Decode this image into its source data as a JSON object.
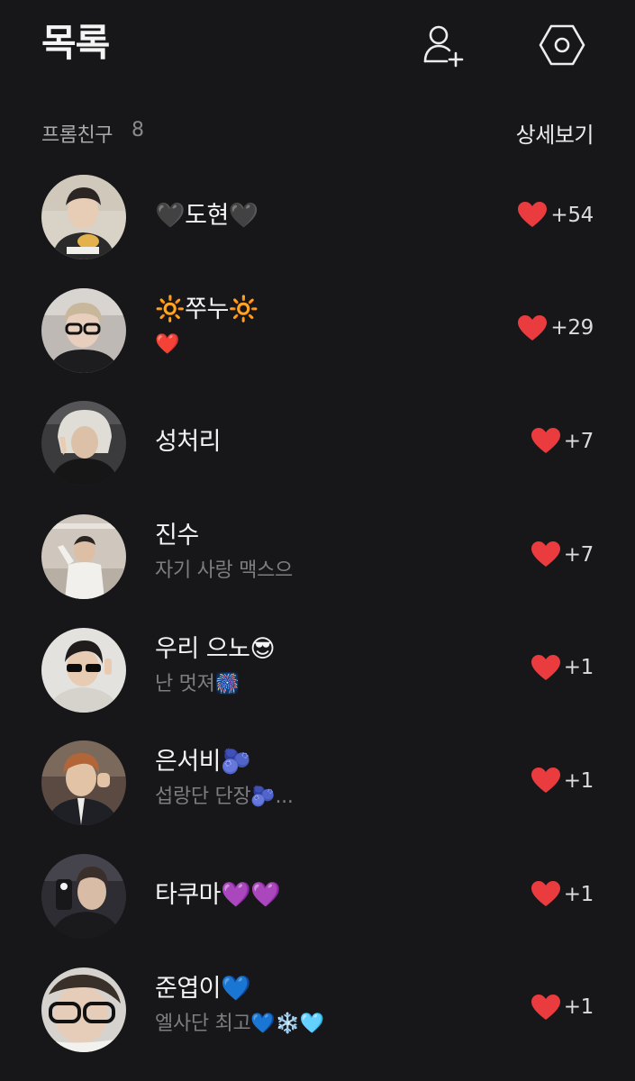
{
  "header": {
    "title": "목록"
  },
  "section": {
    "label": "프롬친구",
    "count": "8",
    "detail_link": "상세보기"
  },
  "friends": [
    {
      "name": "🖤도현🖤",
      "status": "",
      "likes": "+54"
    },
    {
      "name": "🔆쭈누🔆",
      "status": "❤️",
      "likes": "+29"
    },
    {
      "name": "성처리",
      "status": "",
      "likes": "+7"
    },
    {
      "name": "진수",
      "status": "자기 사랑 맥스으",
      "likes": "+7"
    },
    {
      "name": "우리 으노😎",
      "status": "난 멋져🎆",
      "likes": "+1"
    },
    {
      "name": "은서비🫐",
      "status": "섭랑단 단장🫐...",
      "likes": "+1"
    },
    {
      "name": "타쿠마💜💜",
      "status": "",
      "likes": "+1"
    },
    {
      "name": "준엽이💙",
      "status": "엘사단 최고💙❄️🩵",
      "likes": "+1"
    }
  ],
  "colors": {
    "background": "#17171a",
    "heart": "#ea3b3f",
    "text_primary": "#f4f4f4",
    "text_secondary": "#7d7d82"
  },
  "icons": {
    "add_friend": "add-friend-icon",
    "settings": "settings-icon",
    "like": "heart-icon"
  }
}
